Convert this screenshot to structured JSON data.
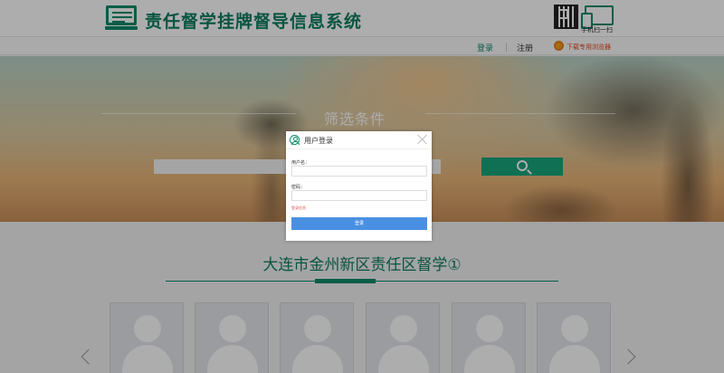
{
  "header": {
    "site_title": "责任督学挂牌督导信息系统",
    "mobile_label": "手机扫一扫"
  },
  "nav": {
    "login": "登录",
    "register": "注册",
    "download": "下载专用浏览器"
  },
  "hero": {
    "title": "筛选条件"
  },
  "section": {
    "title": "大连市金州新区责任区督学①"
  },
  "cards": [
    {
      "name": "card-1"
    },
    {
      "name": "card-2"
    },
    {
      "name": "card-3"
    },
    {
      "name": "card-4"
    },
    {
      "name": "card-5"
    },
    {
      "name": "card-6"
    }
  ],
  "modal": {
    "title": "用户登录",
    "username_label": "用户名：",
    "password_label": "密码：",
    "error_text": "登录信息",
    "login_button": "登录"
  },
  "colors": {
    "brand_green": "#0d8a6a",
    "login_blue": "#4a90e2",
    "search_green": "#17a67c"
  }
}
